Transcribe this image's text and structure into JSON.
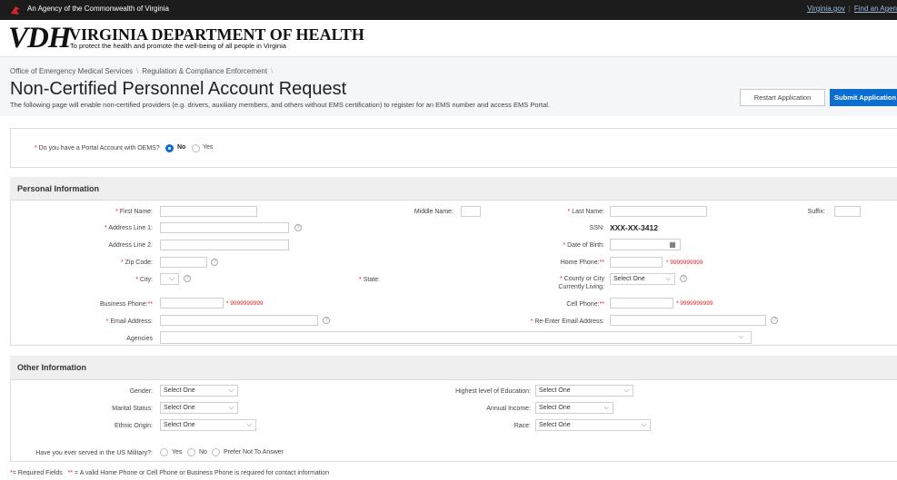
{
  "topbar": {
    "agency": "An Agency of the Commonwealth of Virginia",
    "links": [
      "Virginia.gov",
      "Find an Agen"
    ]
  },
  "brand": {
    "mark": "VDH",
    "title": "VIRGINIA DEPARTMENT OF HEALTH",
    "tagline": "To protect the health and promote the well-being of all people in Virginia"
  },
  "breadcrumb": [
    "Office of Emergency Medical Services",
    "Regulation & Compliance Enforcement"
  ],
  "page": {
    "title": "Non-Certified Personnel Account Request",
    "description": "The following page will enable non-certified providers (e.g. drivers, auxiliary members, and others without EMS certification) to register for an EMS number and access EMS Portal."
  },
  "actions": {
    "restart": "Restart Application",
    "submit": "Submit Application"
  },
  "portal_question": {
    "label": "Do you have a Portal Account with OEMS?",
    "options": [
      "No",
      "Yes"
    ],
    "selected": "No"
  },
  "personal": {
    "heading": "Personal Information",
    "first_name": "First Name:",
    "middle_name": "Middle Name:",
    "last_name": "Last Name:",
    "suffix": "Suffix:",
    "address1": "Address Line 1:",
    "ssn_label": "SSN:",
    "ssn_value": "XXX-XX-3412",
    "address2": "Address Line 2:",
    "dob": "Date of Birth:",
    "zip": "Zip Code:",
    "home_phone": "Home Phone:",
    "home_phone_hint": "* 9999999999",
    "city": "City:",
    "state": "State:",
    "county_line1": "County or City",
    "county_line2": "Currently Living:",
    "county_value": "Select One",
    "business_phone": "Business Phone:",
    "business_phone_hint": "* 9999999999",
    "cell_phone": "Cell Phone:",
    "cell_phone_hint": "* 9999999999",
    "email": "Email Address:",
    "reemail": "Re-Enter Email Address:",
    "agencies": "Agencies"
  },
  "other": {
    "heading": "Other Information",
    "gender": "Gender:",
    "gender_value": "Select One",
    "education": "Highest level of Education:",
    "education_value": "Select One",
    "marital": "Marital Status:",
    "marital_value": "Select One",
    "income": "Annual Income:",
    "income_value": "Select One",
    "ethnic": "Ethnic Origin:",
    "ethnic_value": "Select One",
    "race": "Race:",
    "race_value": "Select One",
    "military": "Have you ever served in the US Military?:",
    "military_options": [
      "Yes",
      "No",
      "Prefer Not To Answer"
    ]
  },
  "footnote": {
    "req1": "*",
    "text1": "= Required Fields",
    "req2": "**",
    "text2": "= A valid Home Phone or Cell Phone or Business Phone is required for contact information"
  },
  "colors": {
    "accent": "#0a6ed1",
    "required": "#dd2222",
    "topbar": "#1c1c1c"
  },
  "icons": {
    "info": "info-circle-icon",
    "calendar": "calendar-icon",
    "chevron": "chevron-down-icon",
    "va": "virginia-cardinal-icon"
  }
}
